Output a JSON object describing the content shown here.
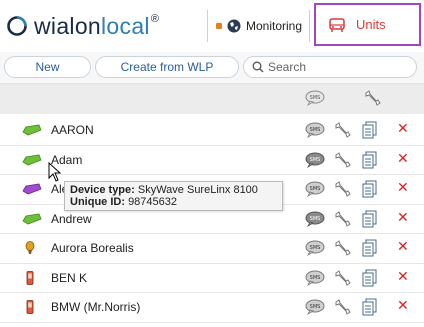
{
  "header": {
    "logo_main": "wialon",
    "logo_local": "local",
    "logo_sup": "®",
    "nav_monitoring": "Monitoring",
    "nav_units": "Units"
  },
  "toolbar": {
    "new_label": "New",
    "create_from_wlp_label": "Create from WLP",
    "search_placeholder": "Search"
  },
  "table": {
    "columns": [
      "SMS",
      "Settings"
    ],
    "units": [
      {
        "name": "AARON",
        "icon": "green-car-icon"
      },
      {
        "name": "Adam",
        "icon": "green-car-icon"
      },
      {
        "name": "Ale",
        "icon": "purple-car-icon"
      },
      {
        "name": "Andrew",
        "icon": "green-car-icon"
      },
      {
        "name": "Aurora Borealis",
        "icon": "balloon-icon"
      },
      {
        "name": "BEN K",
        "icon": "phone-icon"
      },
      {
        "name": "BMW (Mr.Norris)",
        "icon": "phone-icon"
      }
    ]
  },
  "tooltip": {
    "device_type_label": "Device type:",
    "device_type_value": "SkyWave SureLinx 8100",
    "unique_id_label": "Unique ID:",
    "unique_id_value": "98745632"
  },
  "colors": {
    "accent_purple": "#a246c8",
    "units_red": "#d83c3c",
    "delete_red": "#e02020",
    "link_blue": "#2a5f9e"
  }
}
